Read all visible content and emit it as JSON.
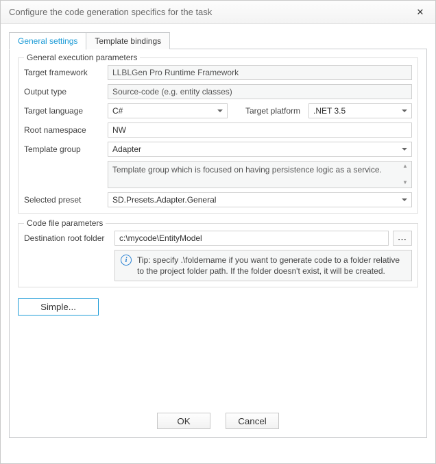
{
  "window": {
    "title": "Configure the code generation specifics for the task"
  },
  "tabs": {
    "general": "General settings",
    "bindings": "Template bindings"
  },
  "groups": {
    "exec": "General execution parameters",
    "file": "Code file parameters"
  },
  "labels": {
    "target_framework": "Target framework",
    "output_type": "Output type",
    "target_language": "Target language",
    "target_platform": "Target platform",
    "root_namespace": "Root namespace",
    "template_group": "Template group",
    "selected_preset": "Selected preset",
    "destination_folder": "Destination root folder"
  },
  "values": {
    "target_framework": "LLBLGen Pro Runtime Framework",
    "output_type": "Source-code (e.g. entity classes)",
    "target_language": "C#",
    "target_platform": ".NET 3.5",
    "root_namespace": "NW",
    "template_group": "Adapter",
    "template_group_desc": "Template group which is focused on having persistence logic as a service.",
    "selected_preset": "SD.Presets.Adapter.General",
    "destination_folder": "c:\\mycode\\EntityModel",
    "tip": "Tip: specify .\\foldername if you want to generate code to a folder relative to the project folder path. If the folder doesn't exist, it will be created."
  },
  "buttons": {
    "simple": "Simple...",
    "browse": "...",
    "ok": "OK",
    "cancel": "Cancel"
  }
}
